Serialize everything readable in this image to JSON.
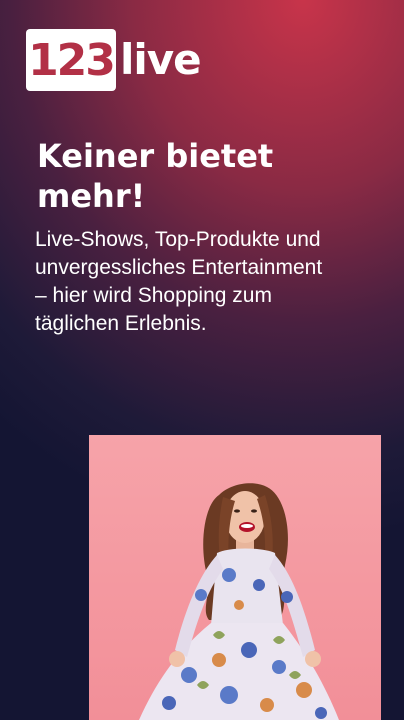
{
  "logo": {
    "number": "123",
    "word": "live"
  },
  "hero": {
    "headline": "Keiner bietet mehr!",
    "description": "Live-Shows, Top-Produkte und unvergessliches Entertainment – hier wird Shopping zum täglichen Erlebnis."
  },
  "colors": {
    "brand_red": "#b23046",
    "photo_background": "#f4979e"
  }
}
